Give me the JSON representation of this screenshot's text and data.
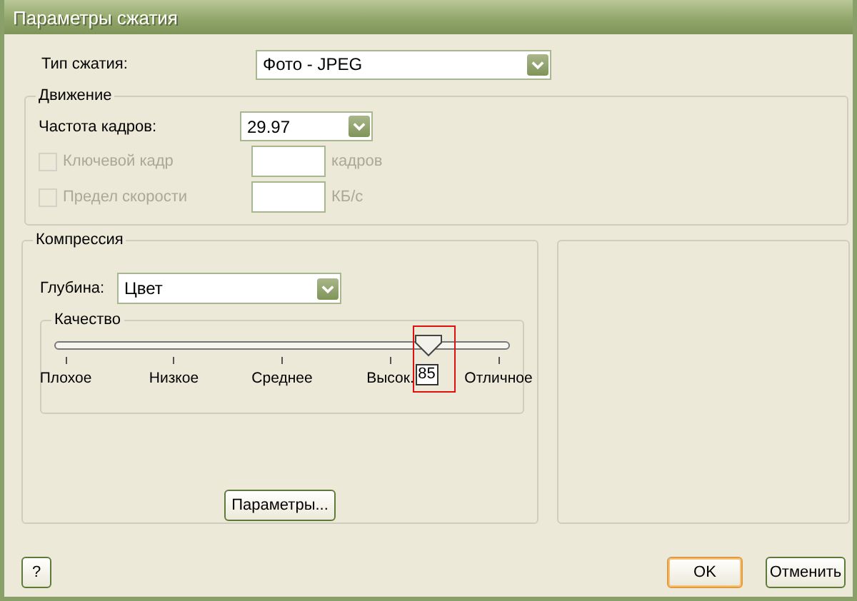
{
  "window": {
    "title": "Параметры сжатия"
  },
  "compression_type": {
    "label": "Тип  сжатия:",
    "value": "Фото - JPEG"
  },
  "motion": {
    "title": "Движение",
    "frame_rate": {
      "label": "Частота кадров:",
      "value": "29.97"
    },
    "options": [
      {
        "label": "Ключевой кадр",
        "checked": false,
        "disabled": true,
        "unit": "кадров"
      },
      {
        "label": "Предел скорости",
        "checked": false,
        "disabled": true,
        "unit": "КБ/с"
      }
    ]
  },
  "compression": {
    "title": "Компрессия",
    "depth": {
      "label": "Глубина:",
      "value": "Цвет"
    },
    "quality": {
      "title": "Качество",
      "level": 0.82,
      "value": "85",
      "highlighted": true,
      "ticks": [
        "Плохое",
        "Низкое",
        "Среднее",
        "Высок.",
        "Отличное"
      ]
    },
    "settings_button": "Параметры..."
  },
  "buttons": [
    {
      "kind": "help",
      "label": "?"
    },
    {
      "kind": "default",
      "label": "OK"
    },
    {
      "kind": "normal",
      "label": "Отменить"
    }
  ]
}
